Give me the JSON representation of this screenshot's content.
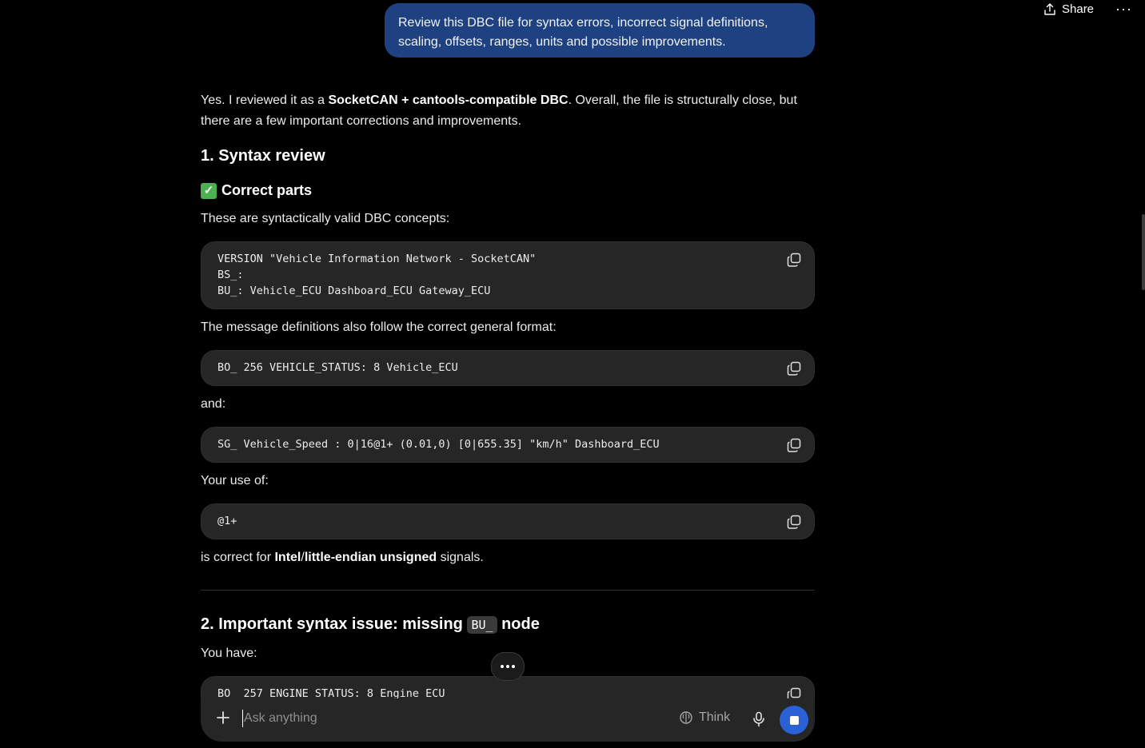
{
  "header": {
    "share_label": "Share",
    "more_label": "···"
  },
  "user_message": "Review this DBC file for syntax errors, incorrect signal definitions, scaling, offsets, ranges, units and possible improvements.",
  "response": {
    "intro_prefix": "Yes. I reviewed it as a ",
    "intro_bold": "SocketCAN + cantools-compatible DBC",
    "intro_suffix": ". Overall, the file is structurally close, but there are a few important corrections and improvements.",
    "section1_title": "1. Syntax review",
    "subsection_title": "Correct parts",
    "valid_concepts_text": "These are syntactically valid DBC concepts:",
    "code1_lines": [
      "VERSION \"Vehicle Information Network - SocketCAN\"",
      "BS_:",
      "BU_: Vehicle_ECU Dashboard_ECU Gateway_ECU"
    ],
    "message_defs_text": "The message definitions also follow the correct general format:",
    "code2": "BO_ 256 VEHICLE_STATUS: 8 Vehicle_ECU",
    "and_text": "and:",
    "code3": "SG_ Vehicle_Speed : 0|16@1+ (0.01,0) [0|655.35] \"km/h\" Dashboard_ECU",
    "your_use_text": "Your use of:",
    "code4": "@1+",
    "correct_prefix": "is correct for ",
    "correct_bold1": "Intel",
    "correct_sep": "/",
    "correct_bold2": "little-endian unsigned",
    "correct_suffix": " signals.",
    "section2_prefix": "2. Important syntax issue: missing ",
    "section2_code": "BU_",
    "section2_suffix": " node",
    "you_have_text": "You have:",
    "code5": "BO_ 257 ENGINE_STATUS: 8 Engine_ECU"
  },
  "composer": {
    "placeholder": "Ask anything",
    "think_label": "Think"
  }
}
